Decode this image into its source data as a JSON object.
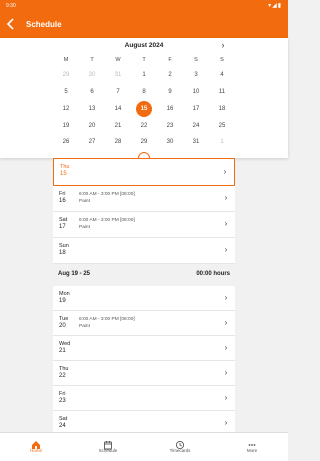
{
  "status": {
    "time": "9:30",
    "icons": "▾◢▮"
  },
  "appbar": {
    "title": "Schedule",
    "back_icon": "back-arrow-icon"
  },
  "calendar": {
    "month_label": "August 2024",
    "weekdays": [
      "M",
      "T",
      "W",
      "T",
      "F",
      "S",
      "S"
    ],
    "weeks": [
      [
        "29",
        "30",
        "31",
        "1",
        "2",
        "3",
        "4"
      ],
      [
        "5",
        "6",
        "7",
        "8",
        "9",
        "10",
        "11"
      ],
      [
        "12",
        "13",
        "14",
        "15",
        "16",
        "17",
        "18"
      ],
      [
        "19",
        "20",
        "21",
        "22",
        "23",
        "24",
        "25"
      ],
      [
        "26",
        "27",
        "28",
        "29",
        "30",
        "31",
        "1"
      ]
    ],
    "selected_day": "15",
    "accent": "#f26b0f"
  },
  "week1": {
    "days": [
      {
        "name": "Thu",
        "num": "15",
        "shift": "",
        "task": "",
        "today": true
      },
      {
        "name": "Fri",
        "num": "16",
        "shift": "6:00 AM - 3:00 PM [08:00]",
        "task": "Paint"
      },
      {
        "name": "Sat",
        "num": "17",
        "shift": "6:00 AM - 3:00 PM [08:00]",
        "task": "Paint"
      },
      {
        "name": "Sun",
        "num": "18",
        "shift": "",
        "task": ""
      }
    ]
  },
  "week2": {
    "range": "Aug 19 - 25",
    "hours": "00:00 hours",
    "days": [
      {
        "name": "Mon",
        "num": "19",
        "shift": "",
        "task": ""
      },
      {
        "name": "Tue",
        "num": "20",
        "shift": "6:00 AM - 3:00 PM [08:00]",
        "task": "Paint"
      },
      {
        "name": "Wed",
        "num": "21",
        "shift": "",
        "task": ""
      },
      {
        "name": "Thu",
        "num": "22",
        "shift": "",
        "task": ""
      },
      {
        "name": "Fri",
        "num": "23",
        "shift": "",
        "task": ""
      },
      {
        "name": "Sat",
        "num": "24",
        "shift": "",
        "task": ""
      }
    ]
  },
  "nav": {
    "items": [
      {
        "label": "Home",
        "icon": "home-icon",
        "active": true
      },
      {
        "label": "Schedule",
        "icon": "calendar-icon"
      },
      {
        "label": "Timecards",
        "icon": "clock-icon"
      },
      {
        "label": "More",
        "icon": "more-dots-icon"
      }
    ]
  }
}
